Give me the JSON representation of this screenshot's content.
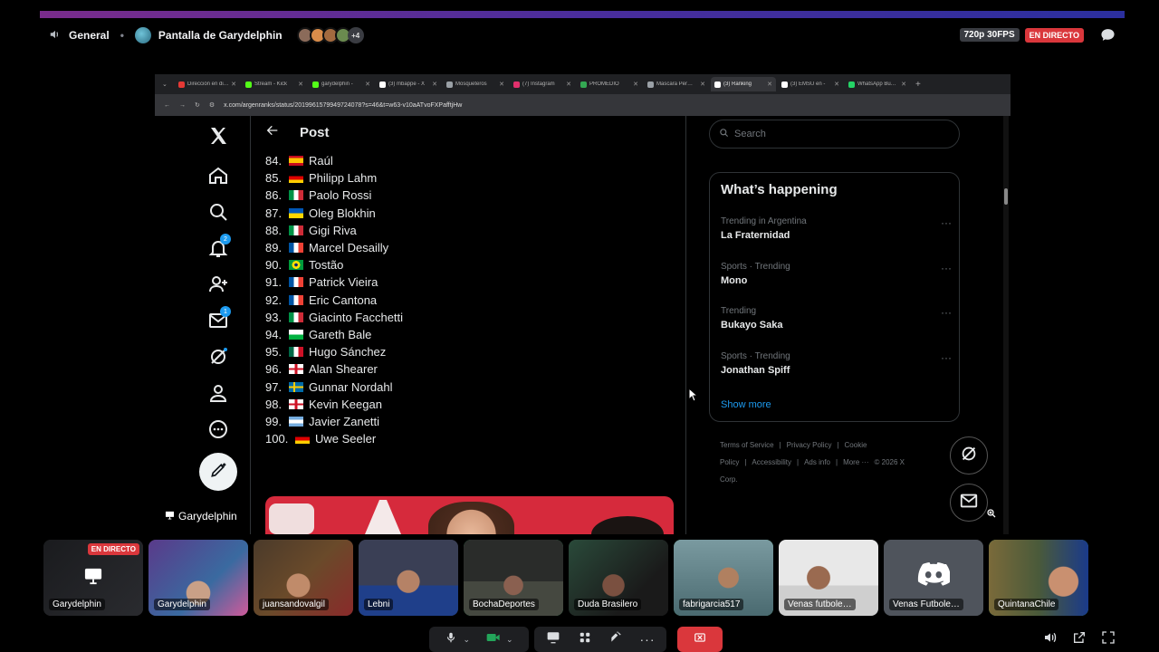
{
  "header": {
    "channel": "General",
    "stream_title": "Pantalla de Garydelphin",
    "more_viewers": "+4",
    "quality": "720p 30FPS",
    "live_badge": "EN DIRECTO"
  },
  "browser": {
    "tabs": [
      {
        "label": "Dirección en di…",
        "color": "#e53935"
      },
      {
        "label": "Stream - Kick",
        "color": "#53fc18"
      },
      {
        "label": "garydelphin -",
        "color": "#53fc18"
      },
      {
        "label": "(3) mbappe - X",
        "color": "#ffffff"
      },
      {
        "label": "Mosqueteros",
        "color": "#9aa0a6"
      },
      {
        "label": "(7) Instagram",
        "color": "#e1306c"
      },
      {
        "label": "PROMEDIO",
        "color": "#34a853"
      },
      {
        "label": "Mascara Per…",
        "color": "#9aa0a6"
      },
      {
        "label": "(3) Ranking",
        "color": "#ffffff",
        "active": true
      },
      {
        "label": "(3) EMSU en -",
        "color": "#ffffff"
      },
      {
        "label": "WhatsApp Bu…",
        "color": "#25d366"
      }
    ],
    "url": "x.com/argenranks/status/2019961579949724078?s=46&t=w63-v10aATvoFXPafftjHw"
  },
  "x": {
    "post_title": "Post",
    "ranking": [
      {
        "num": "84.",
        "name": "Raúl",
        "flag": "es"
      },
      {
        "num": "85.",
        "name": "Philipp Lahm",
        "flag": "de"
      },
      {
        "num": "86.",
        "name": "Paolo Rossi",
        "flag": "it"
      },
      {
        "num": "87.",
        "name": "Oleg Blokhin",
        "flag": "ua"
      },
      {
        "num": "88.",
        "name": "Gigi Riva",
        "flag": "it"
      },
      {
        "num": "89.",
        "name": "Marcel Desailly",
        "flag": "fr"
      },
      {
        "num": "90.",
        "name": "Tostão",
        "flag": "br"
      },
      {
        "num": "91.",
        "name": "Patrick Vieira",
        "flag": "fr"
      },
      {
        "num": "92.",
        "name": "Eric Cantona",
        "flag": "fr"
      },
      {
        "num": "93.",
        "name": "Giacinto Facchetti",
        "flag": "it"
      },
      {
        "num": "94.",
        "name": "Gareth Bale",
        "flag": "wales"
      },
      {
        "num": "95.",
        "name": "Hugo Sánchez",
        "flag": "mx"
      },
      {
        "num": "96.",
        "name": "Alan Shearer",
        "flag": "eng"
      },
      {
        "num": "97.",
        "name": "Gunnar Nordahl",
        "flag": "se"
      },
      {
        "num": "98.",
        "name": "Kevin Keegan",
        "flag": "eng"
      },
      {
        "num": "99.",
        "name": "Javier Zanetti",
        "flag": "ar"
      },
      {
        "num": "100.",
        "name": "Uwe Seeler",
        "flag": "de"
      }
    ],
    "nav_badges": {
      "notifications": "2",
      "messages": "1"
    },
    "search_placeholder": "Search",
    "happening_title": "What’s happening",
    "trends": [
      {
        "meta": "Trending in Argentina",
        "name": "La Fraternidad"
      },
      {
        "meta": "Sports · Trending",
        "name": "Mono"
      },
      {
        "meta": "Trending",
        "name": "Bukayo Saka"
      },
      {
        "meta": "Sports · Trending",
        "name": "Jonathan Spiff"
      }
    ],
    "trend_more": "···",
    "show_more": "Show more",
    "footer": [
      "Terms of Service",
      "|",
      "Privacy Policy",
      "|",
      "Cookie Policy",
      "|",
      "Accessibility",
      "|",
      "Ads info",
      "|",
      "More ···",
      "© 2026 X Corp."
    ]
  },
  "stream_owner_label": "Garydelphin",
  "participants": [
    {
      "name": "Garydelphin",
      "live": "EN DIRECTO",
      "kind": "screen"
    },
    {
      "name": "Garydelphin",
      "kind": "cam"
    },
    {
      "name": "juansandovalgil",
      "kind": "cam"
    },
    {
      "name": "Lebni",
      "kind": "cam"
    },
    {
      "name": "BochaDeportes",
      "kind": "cam",
      "speaking": true
    },
    {
      "name": "Duda Brasilero",
      "kind": "cam"
    },
    {
      "name": "fabrigarcia517",
      "kind": "cam",
      "speaking": true
    },
    {
      "name": "Venas futbole…",
      "kind": "cam"
    },
    {
      "name": "Venas Futbole…",
      "kind": "discord"
    },
    {
      "name": "QuintanaChile",
      "kind": "cam",
      "speaking": true
    }
  ]
}
